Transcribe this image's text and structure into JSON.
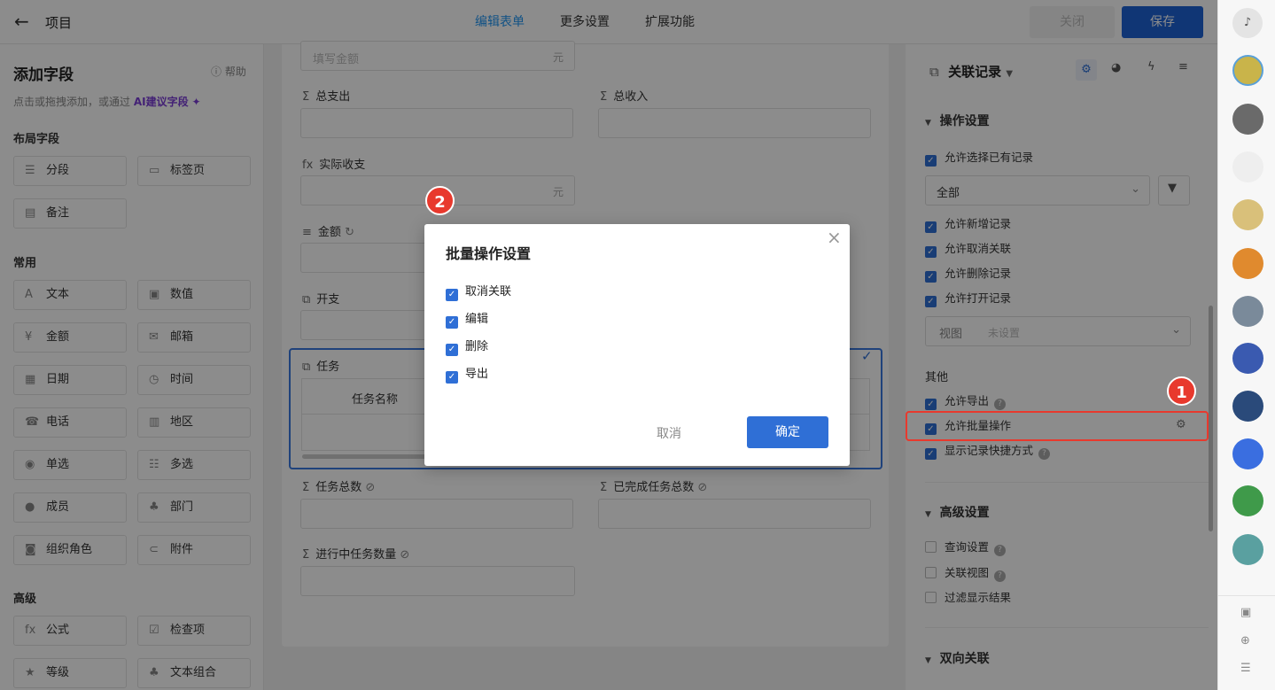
{
  "topbar": {
    "back_icon": "arrow-left-icon",
    "title": "项目",
    "tabs": [
      "编辑表单",
      "更多设置",
      "扩展功能"
    ],
    "close_label": "关闭",
    "save_label": "保存"
  },
  "left": {
    "title": "添加字段",
    "help": "帮助",
    "hint_prefix": "点击或拖拽添加，或通过",
    "hint_ai": "AI建议字段",
    "sections": [
      {
        "title": "布局字段",
        "items": [
          {
            "label": "分段",
            "icon": "section-icon"
          },
          {
            "label": "标签页",
            "icon": "tab-icon"
          },
          {
            "label": "备注",
            "icon": "note-icon"
          }
        ]
      },
      {
        "title": "常用",
        "items": [
          {
            "label": "文本",
            "icon": "text-icon"
          },
          {
            "label": "数值",
            "icon": "number-icon"
          },
          {
            "label": "金额",
            "icon": "money-icon"
          },
          {
            "label": "邮箱",
            "icon": "mail-icon"
          },
          {
            "label": "日期",
            "icon": "calendar-icon"
          },
          {
            "label": "时间",
            "icon": "clock-icon"
          },
          {
            "label": "电话",
            "icon": "phone-icon"
          },
          {
            "label": "地区",
            "icon": "map-icon"
          },
          {
            "label": "单选",
            "icon": "radio-icon"
          },
          {
            "label": "多选",
            "icon": "multi-select-icon"
          },
          {
            "label": "成员",
            "icon": "member-icon"
          },
          {
            "label": "部门",
            "icon": "department-icon"
          },
          {
            "label": "组织角色",
            "icon": "role-icon"
          },
          {
            "label": "附件",
            "icon": "attachment-icon"
          }
        ]
      },
      {
        "title": "高级",
        "items": [
          {
            "label": "公式",
            "icon": "formula-icon"
          },
          {
            "label": "检查项",
            "icon": "checkbox-icon"
          },
          {
            "label": "等级",
            "icon": "star-icon"
          },
          {
            "label": "文本组合",
            "icon": "text-combo-icon"
          }
        ]
      }
    ]
  },
  "form": {
    "amount_placeholder": "填写金额",
    "unit": "元",
    "total_expense": "总支出",
    "total_income": "总收入",
    "actual": "实际收支",
    "amount": "金额",
    "kaizhi": "开支",
    "task": "任务",
    "task_col": "任务名称",
    "task_total": "任务总数",
    "task_done": "已完成任务总数",
    "task_inprogress": "进行中任务数量"
  },
  "right": {
    "field_type": "关联记录",
    "op_section": "操作设置",
    "allow_select": "允许选择已有记录",
    "filter_value": "全部",
    "allow_add": "允许新增记录",
    "allow_unlink": "允许取消关联",
    "allow_delete": "允许删除记录",
    "allow_open": "允许打开记录",
    "view_label": "视图",
    "view_value": "未设置",
    "other": "其他",
    "allow_export": "允许导出",
    "allow_batch": "允许批量操作",
    "show_shortcut": "显示记录快捷方式",
    "adv_section": "高级设置",
    "query": "查询设置",
    "link_view": "关联视图",
    "filter_result": "过滤显示结果",
    "bi_section": "双向关联"
  },
  "modal": {
    "title": "批量操作设置",
    "options": [
      "取消关联",
      "编辑",
      "删除",
      "导出"
    ],
    "cancel": "取消",
    "ok": "确定"
  },
  "badges": {
    "one": "1",
    "two": "2"
  },
  "colors": {
    "primary": "#2f6fd6",
    "save": "#1e63d6",
    "accent": "#e8392d",
    "ai": "#7b3cd6"
  }
}
